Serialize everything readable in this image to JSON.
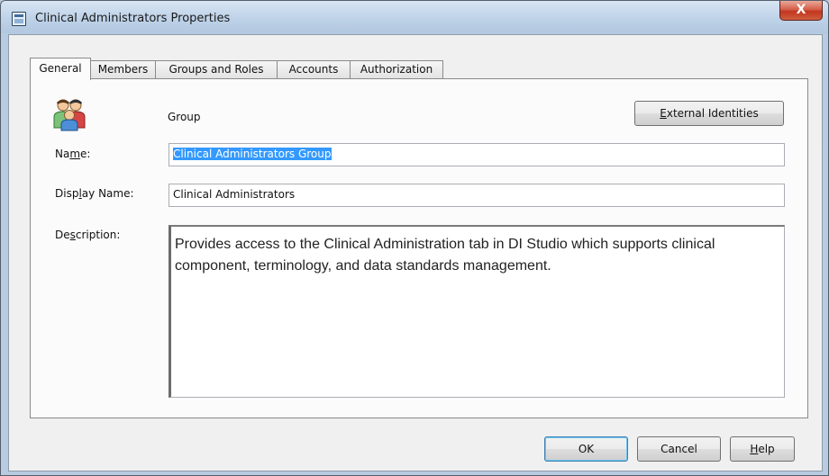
{
  "window": {
    "title": "Clinical Administrators Properties",
    "close_label": "X"
  },
  "tabs": [
    {
      "label": "General",
      "active": true
    },
    {
      "label": "Members",
      "active": false
    },
    {
      "label": "Groups and Roles",
      "active": false
    },
    {
      "label": "Accounts",
      "active": false
    },
    {
      "label": "Authorization",
      "active": false
    }
  ],
  "general": {
    "icon": "group-icon",
    "type_label": "Group",
    "external_identities_label": "External Identities",
    "name_label": "Name:",
    "name_value": "Clinical Administrators Group",
    "display_name_label": "Display Name:",
    "display_name_value": "Clinical Administrators",
    "description_label": "Description:",
    "description_value": "Provides access to the Clinical Administration tab in DI Studio which supports clinical component, terminology, and data standards management."
  },
  "buttons": {
    "ok": "OK",
    "cancel": "Cancel",
    "help": "Help"
  },
  "colors": {
    "selection": "#3399ff",
    "titlebar": "#bed2e8",
    "close": "#c2361f"
  }
}
